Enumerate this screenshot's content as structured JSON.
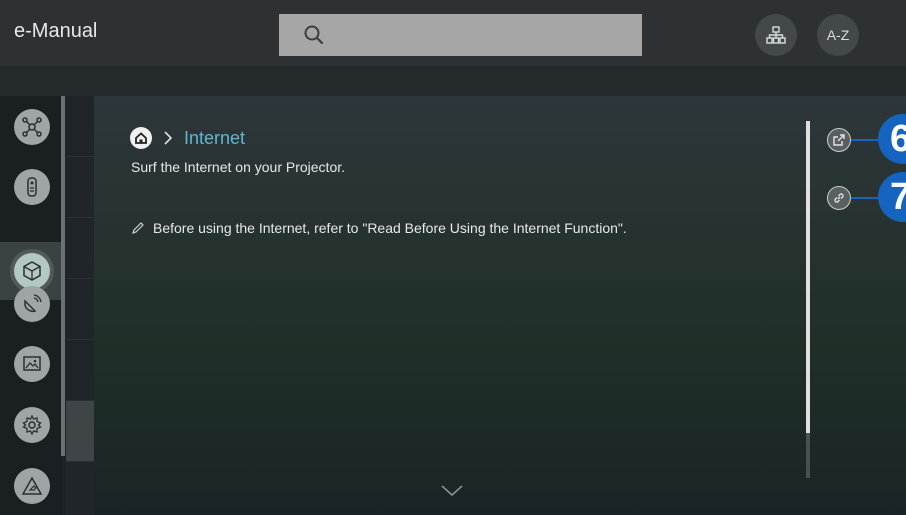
{
  "header": {
    "title": "e-Manual",
    "search_placeholder": "",
    "sitemap_icon": "sitemap-icon",
    "az_label": "A-Z"
  },
  "sidebar": {
    "items": [
      {
        "icon": "network-icon"
      },
      {
        "icon": "remote-icon"
      },
      {
        "icon": "smart-hub-icon",
        "active": true
      },
      {
        "icon": "satellite-dish-icon"
      },
      {
        "icon": "picture-icon"
      },
      {
        "icon": "settings-icon"
      },
      {
        "icon": "warning-icon"
      }
    ]
  },
  "breadcrumb": {
    "home_icon": "home-icon",
    "current": "Internet"
  },
  "page": {
    "description": "Surf the Internet on your Projector.",
    "note": "Before using the Internet, refer to \"Read Before Using the Internet Function\"."
  },
  "actions": [
    {
      "icon": "open-external-icon",
      "callout": "6"
    },
    {
      "icon": "link-icon",
      "callout": "7"
    }
  ],
  "colors": {
    "accent": "#5fb7cf",
    "callout": "#1565c0"
  }
}
